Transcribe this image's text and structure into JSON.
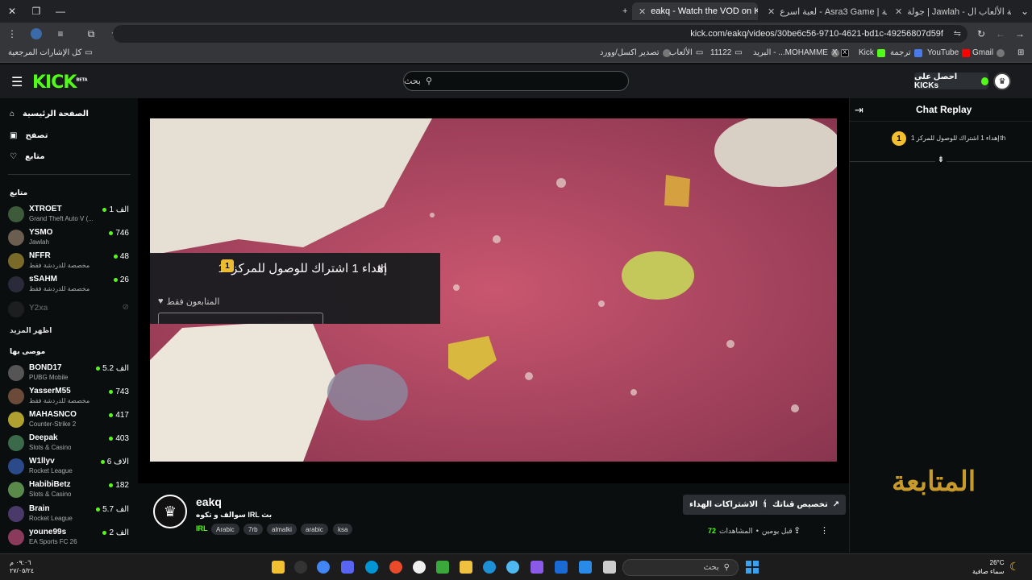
{
  "browser": {
    "tabs": [
      {
        "title": "جولة | Jawlah - منصة الألعاب ال..."
      },
      {
        "title": "لعبة اسرع - Asra3 Game | جولة"
      },
      {
        "title": "eakq - Watch the VOD on Kick",
        "active": true
      }
    ],
    "new_tab": "+",
    "url": "kick.com/eakq/videos/30be6c56-9710-4621-bd1c-49256807d59f",
    "bookmarks": [
      "Gmail",
      "YouTube",
      "ترجمة",
      "Kick",
      "X",
      "البريد - ...MOHAMME",
      "11122",
      "الألعاب",
      "تصدير اكسل/وورد",
      "كل الإشارات المرجعية"
    ]
  },
  "header": {
    "logo": "KICK",
    "beta": "BETA",
    "search_placeholder": "بحث",
    "get_kicks": "احصل على KICKs"
  },
  "sidebar": {
    "nav": [
      {
        "label": "الصفحة الرئيسية",
        "icon": "home-icon"
      },
      {
        "label": "تصفح",
        "icon": "browse-icon"
      },
      {
        "label": "متابع",
        "icon": "heart-icon"
      }
    ],
    "following_title": "متابع",
    "following": [
      {
        "name": "XTROET",
        "game": "Grand Theft Auto V (...",
        "viewers": "1 الف",
        "color": "#3d5a3a"
      },
      {
        "name": "YSMO",
        "game": "Jawlah",
        "viewers": "746",
        "color": "#6b5d4f"
      },
      {
        "name": "NFFR",
        "game": "مخصصة للدردشة فقط",
        "viewers": "48",
        "color": "#7a6a2a"
      },
      {
        "name": "sSAHM",
        "game": "مخصصة للدردشة فقط",
        "viewers": "26",
        "color": "#2a2a3a"
      },
      {
        "name": "Y2xa",
        "game": "",
        "viewers": "",
        "color": "#333",
        "offline": true
      }
    ],
    "show_more": "اظهر المزيد",
    "recommended_title": "موصى بها",
    "recommended": [
      {
        "name": "BOND17",
        "game": "PUBG Mobile",
        "viewers": "5.2 الف",
        "color": "#555"
      },
      {
        "name": "YasserM55",
        "game": "مخصصة للدردشة فقط",
        "viewers": "743",
        "color": "#6b4a3a"
      },
      {
        "name": "MAHASNCO",
        "game": "Counter-Strike 2",
        "viewers": "417",
        "color": "#b0a030"
      },
      {
        "name": "Deepak",
        "game": "Slots & Casino",
        "viewers": "403",
        "color": "#3a6a4a"
      },
      {
        "name": "W1llyv",
        "game": "Rocket League",
        "viewers": "6 الاف",
        "color": "#2a4a8a"
      },
      {
        "name": "HabibiBetz",
        "game": "Slots & Casino",
        "viewers": "182",
        "color": "#5a8a4a"
      },
      {
        "name": "Brain",
        "game": "Rocket League",
        "viewers": "5.7 الف",
        "color": "#4a3a6a"
      },
      {
        "name": "youne99s",
        "game": "EA Sports FC 26",
        "viewers": "2 الف",
        "color": "#8a3a5a"
      }
    ]
  },
  "overlay": {
    "text": "إهداء 1 اشتراك للوصول للمركز: 1",
    "text_suffix": "th",
    "badge": "1",
    "followers_only": "المتابعون فقط"
  },
  "stream": {
    "channel": "eakq",
    "title": "سوالف و تكوه IRL بث",
    "category": "IRL",
    "tags": [
      "Arabic",
      "7rb",
      "almalki",
      "arabic",
      "ksa"
    ],
    "gift_subs": "الاشتراكات الهداء",
    "customize": "تخصيص قناتك",
    "views_label": "المشاهدات",
    "views": "72",
    "time_ago": "قبل يومين"
  },
  "chat": {
    "title": "Chat Replay",
    "message": "إهداء 1 اشتراك للوصول للمركز 1",
    "message_suffix": "th",
    "badge": "1"
  },
  "watermark": "المتابعة",
  "taskbar": {
    "search_placeholder": "بحث",
    "weather_temp": "26°C",
    "weather_desc": "سماء صافية",
    "time": "٠٩:٠٦ م",
    "date": "٢٧/٠٥/٢٤"
  }
}
